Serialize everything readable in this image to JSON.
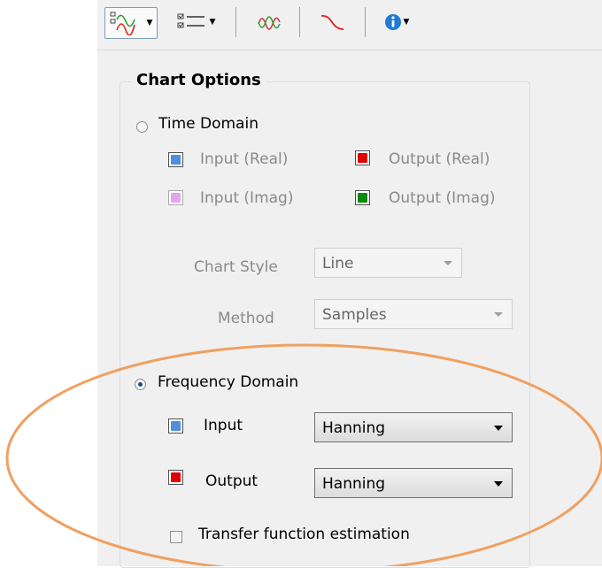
{
  "toolbar": {
    "buttons": [
      {
        "icon": "chart-options-icon",
        "has_dropdown": true,
        "active": true
      },
      {
        "icon": "list-options-icon",
        "has_dropdown": true,
        "active": false
      },
      {
        "icon": "signal-wave-icon",
        "has_dropdown": false,
        "active": false
      },
      {
        "icon": "decay-curve-icon",
        "has_dropdown": false,
        "active": false
      },
      {
        "icon": "info-icon",
        "has_dropdown": true,
        "active": false
      }
    ]
  },
  "chart_options": {
    "title": "Chart Options",
    "time_domain": {
      "label": "Time Domain",
      "selected": false,
      "channels": [
        {
          "label": "Input (Real)",
          "color": "#4f8fdd"
        },
        {
          "label": "Output (Real)",
          "color": "#e00000"
        },
        {
          "label": "Input (Imag)",
          "color": "#e0a8e8"
        },
        {
          "label": "Output (Imag)",
          "color": "#0a8a0a"
        }
      ],
      "chart_style": {
        "label": "Chart Style",
        "value": "Line"
      },
      "method": {
        "label": "Method",
        "value": "Samples"
      }
    },
    "frequency_domain": {
      "label": "Frequency Domain",
      "selected": true,
      "input": {
        "label": "Input",
        "color": "#4f8fdd",
        "window": "Hanning"
      },
      "output": {
        "label": "Output",
        "color": "#e00000",
        "window": "Hanning"
      },
      "transfer_function": {
        "label": "Transfer function estimation",
        "checked": false
      }
    }
  },
  "annotation": {
    "color": "#f0a060"
  }
}
